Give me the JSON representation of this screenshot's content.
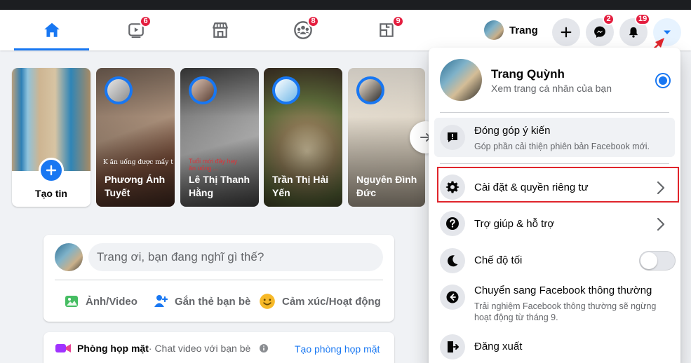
{
  "nav": {
    "tabs": [
      {
        "name": "home-icon",
        "badge": ""
      },
      {
        "name": "watch-icon",
        "badge": "6"
      },
      {
        "name": "marketplace-icon",
        "badge": ""
      },
      {
        "name": "groups-icon",
        "badge": "8"
      },
      {
        "name": "gaming-icon",
        "badge": "9"
      }
    ],
    "profile_name": "Trang",
    "messenger_badge": "2",
    "notifications_badge": "19"
  },
  "stories": {
    "create_label": "Tạo tin",
    "items": [
      {
        "name": "Phương Ánh Tuyết",
        "overlay": "K ăn uống được mấy t"
      },
      {
        "name": "Lê Thị Thanh Hằng",
        "overlay": "Tuổi mới đây hay ăn uống ..."
      },
      {
        "name": "Trần Thị Hải Yến",
        "overlay": ""
      },
      {
        "name": "Nguyên Đình Đức",
        "overlay": ""
      }
    ]
  },
  "composer": {
    "placeholder": "Trang ơi, bạn đang nghĩ gì thế?",
    "actions": [
      "Ảnh/Video",
      "Gắn thẻ bạn bè",
      "Cảm xúc/Hoạt động"
    ]
  },
  "rooms": {
    "title": "Phòng họp mặt",
    "subtitle": " · Chat video với bạn bè",
    "link": "Tạo phòng họp mặt"
  },
  "menu": {
    "user_name": "Trang Quỳnh",
    "user_sub": "Xem trang cá nhân của bạn",
    "feedback_title": "Đóng góp ý kiến",
    "feedback_sub": "Góp phần cải thiện phiên bản Facebook mới.",
    "settings": "Cài đặt & quyền riêng tư",
    "help": "Trợ giúp & hỗ trợ",
    "dark_mode": "Chế độ tối",
    "switch_title": "Chuyển sang Facebook thông thường",
    "switch_sub": "Trải nghiệm Facebook thông thường sẽ ngừng hoạt động từ tháng 9.",
    "logout": "Đăng xuất"
  },
  "colors": {
    "accent": "#1877f2",
    "badge": "#e41e3f",
    "annotation": "#e0242b"
  }
}
